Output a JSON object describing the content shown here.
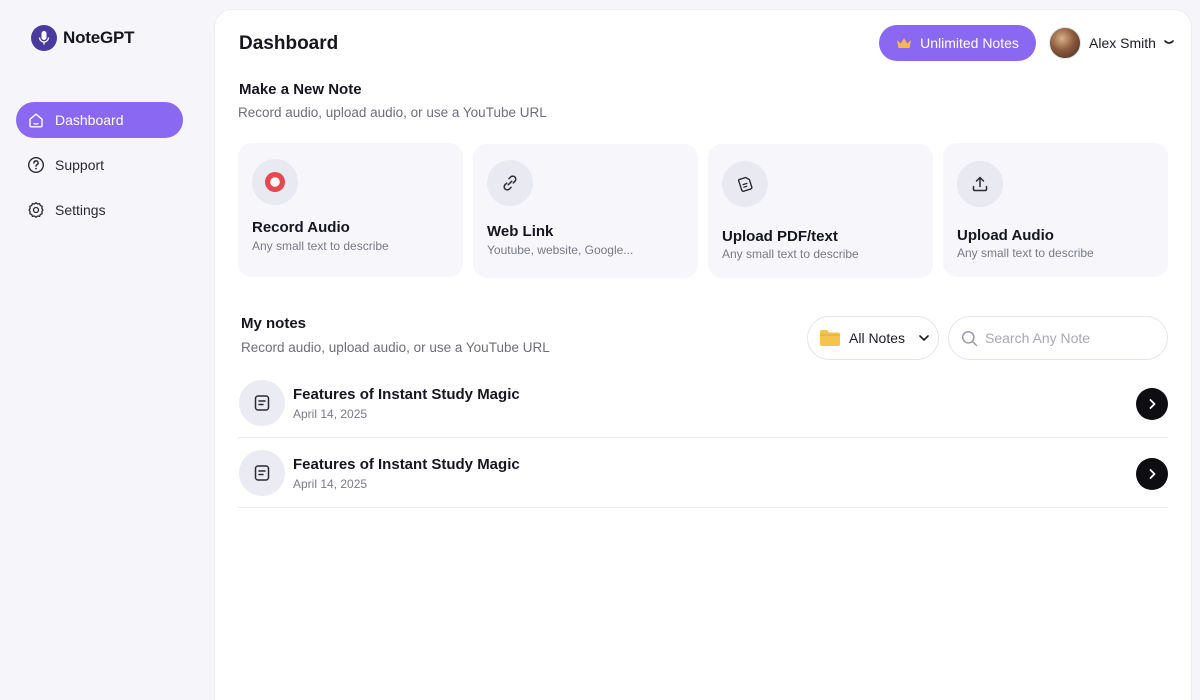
{
  "app": {
    "name": "NoteGPT"
  },
  "sidebar": {
    "items": [
      {
        "label": "Dashboard",
        "icon": "home-icon",
        "active": true
      },
      {
        "label": "Support",
        "icon": "question-circle-icon",
        "active": false
      },
      {
        "label": "Settings",
        "icon": "gear-icon",
        "active": false
      }
    ]
  },
  "header": {
    "title": "Dashboard",
    "upgrade_label": "Unlimited Notes",
    "user_name": "Alex Smith"
  },
  "new_note": {
    "title": "Make a New Note",
    "subtitle": "Record audio, upload audio, or use a YouTube URL",
    "cards": [
      {
        "title": "Record Audio",
        "desc": "Any small text to describe",
        "icon": "record-icon"
      },
      {
        "title": "Web Link",
        "desc": "Youtube, website, Google...",
        "icon": "link-icon"
      },
      {
        "title": "Upload PDF/text",
        "desc": "Any small text to describe",
        "icon": "document-icon"
      },
      {
        "title": "Upload Audio",
        "desc": "Any small text to describe",
        "icon": "upload-icon"
      }
    ]
  },
  "my_notes": {
    "title": "My notes",
    "subtitle": "Record audio, upload audio, or use a YouTube URL",
    "filter_label": "All Notes",
    "search_placeholder": "Search Any Note",
    "notes": [
      {
        "title": "Features of Instant Study Magic",
        "date": "April 14, 2025"
      },
      {
        "title": "Features of Instant Study Magic",
        "date": "April 14, 2025"
      }
    ]
  },
  "colors": {
    "accent": "#8a68f2",
    "logo": "#4b3a9e",
    "record": "#e5484d",
    "folder": "#f4c44e",
    "crown": "#f6b84a"
  }
}
